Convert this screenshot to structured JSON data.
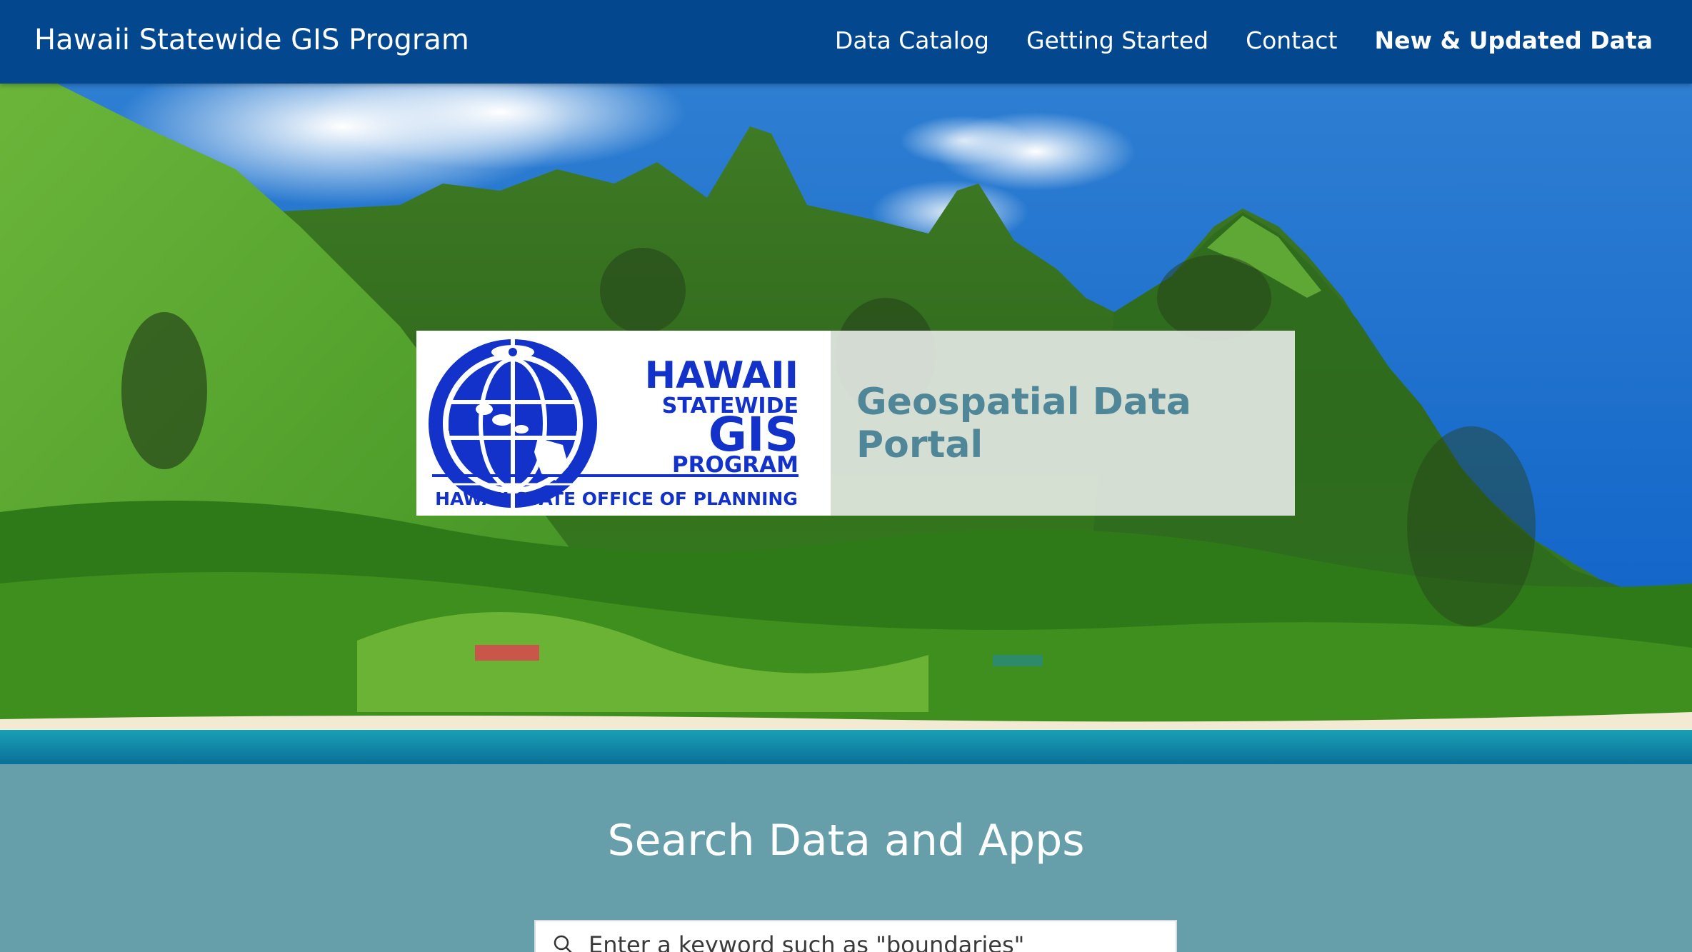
{
  "header": {
    "site_title": "Hawaii Statewide GIS Program",
    "nav": [
      {
        "label": "Data Catalog",
        "active": false
      },
      {
        "label": "Getting Started",
        "active": false
      },
      {
        "label": "Contact",
        "active": false
      },
      {
        "label": "New & Updated Data",
        "active": true
      }
    ]
  },
  "hero": {
    "logo": {
      "line1": "HAWAII",
      "line2": "STATEWIDE",
      "line3": "GIS",
      "line4": "PROGRAM",
      "subline": "HAWAII STATE OFFICE OF PLANNING"
    },
    "portal_title": "Geospatial Data Portal"
  },
  "search": {
    "heading": "Search Data and Apps",
    "placeholder": "Enter a keyword such as \"boundaries\"",
    "icon": "search-icon"
  },
  "colors": {
    "header_bg": "#03478e",
    "search_bg": "#669ea9",
    "logo_blue": "#1232c9",
    "portal_title": "#4f8799"
  }
}
